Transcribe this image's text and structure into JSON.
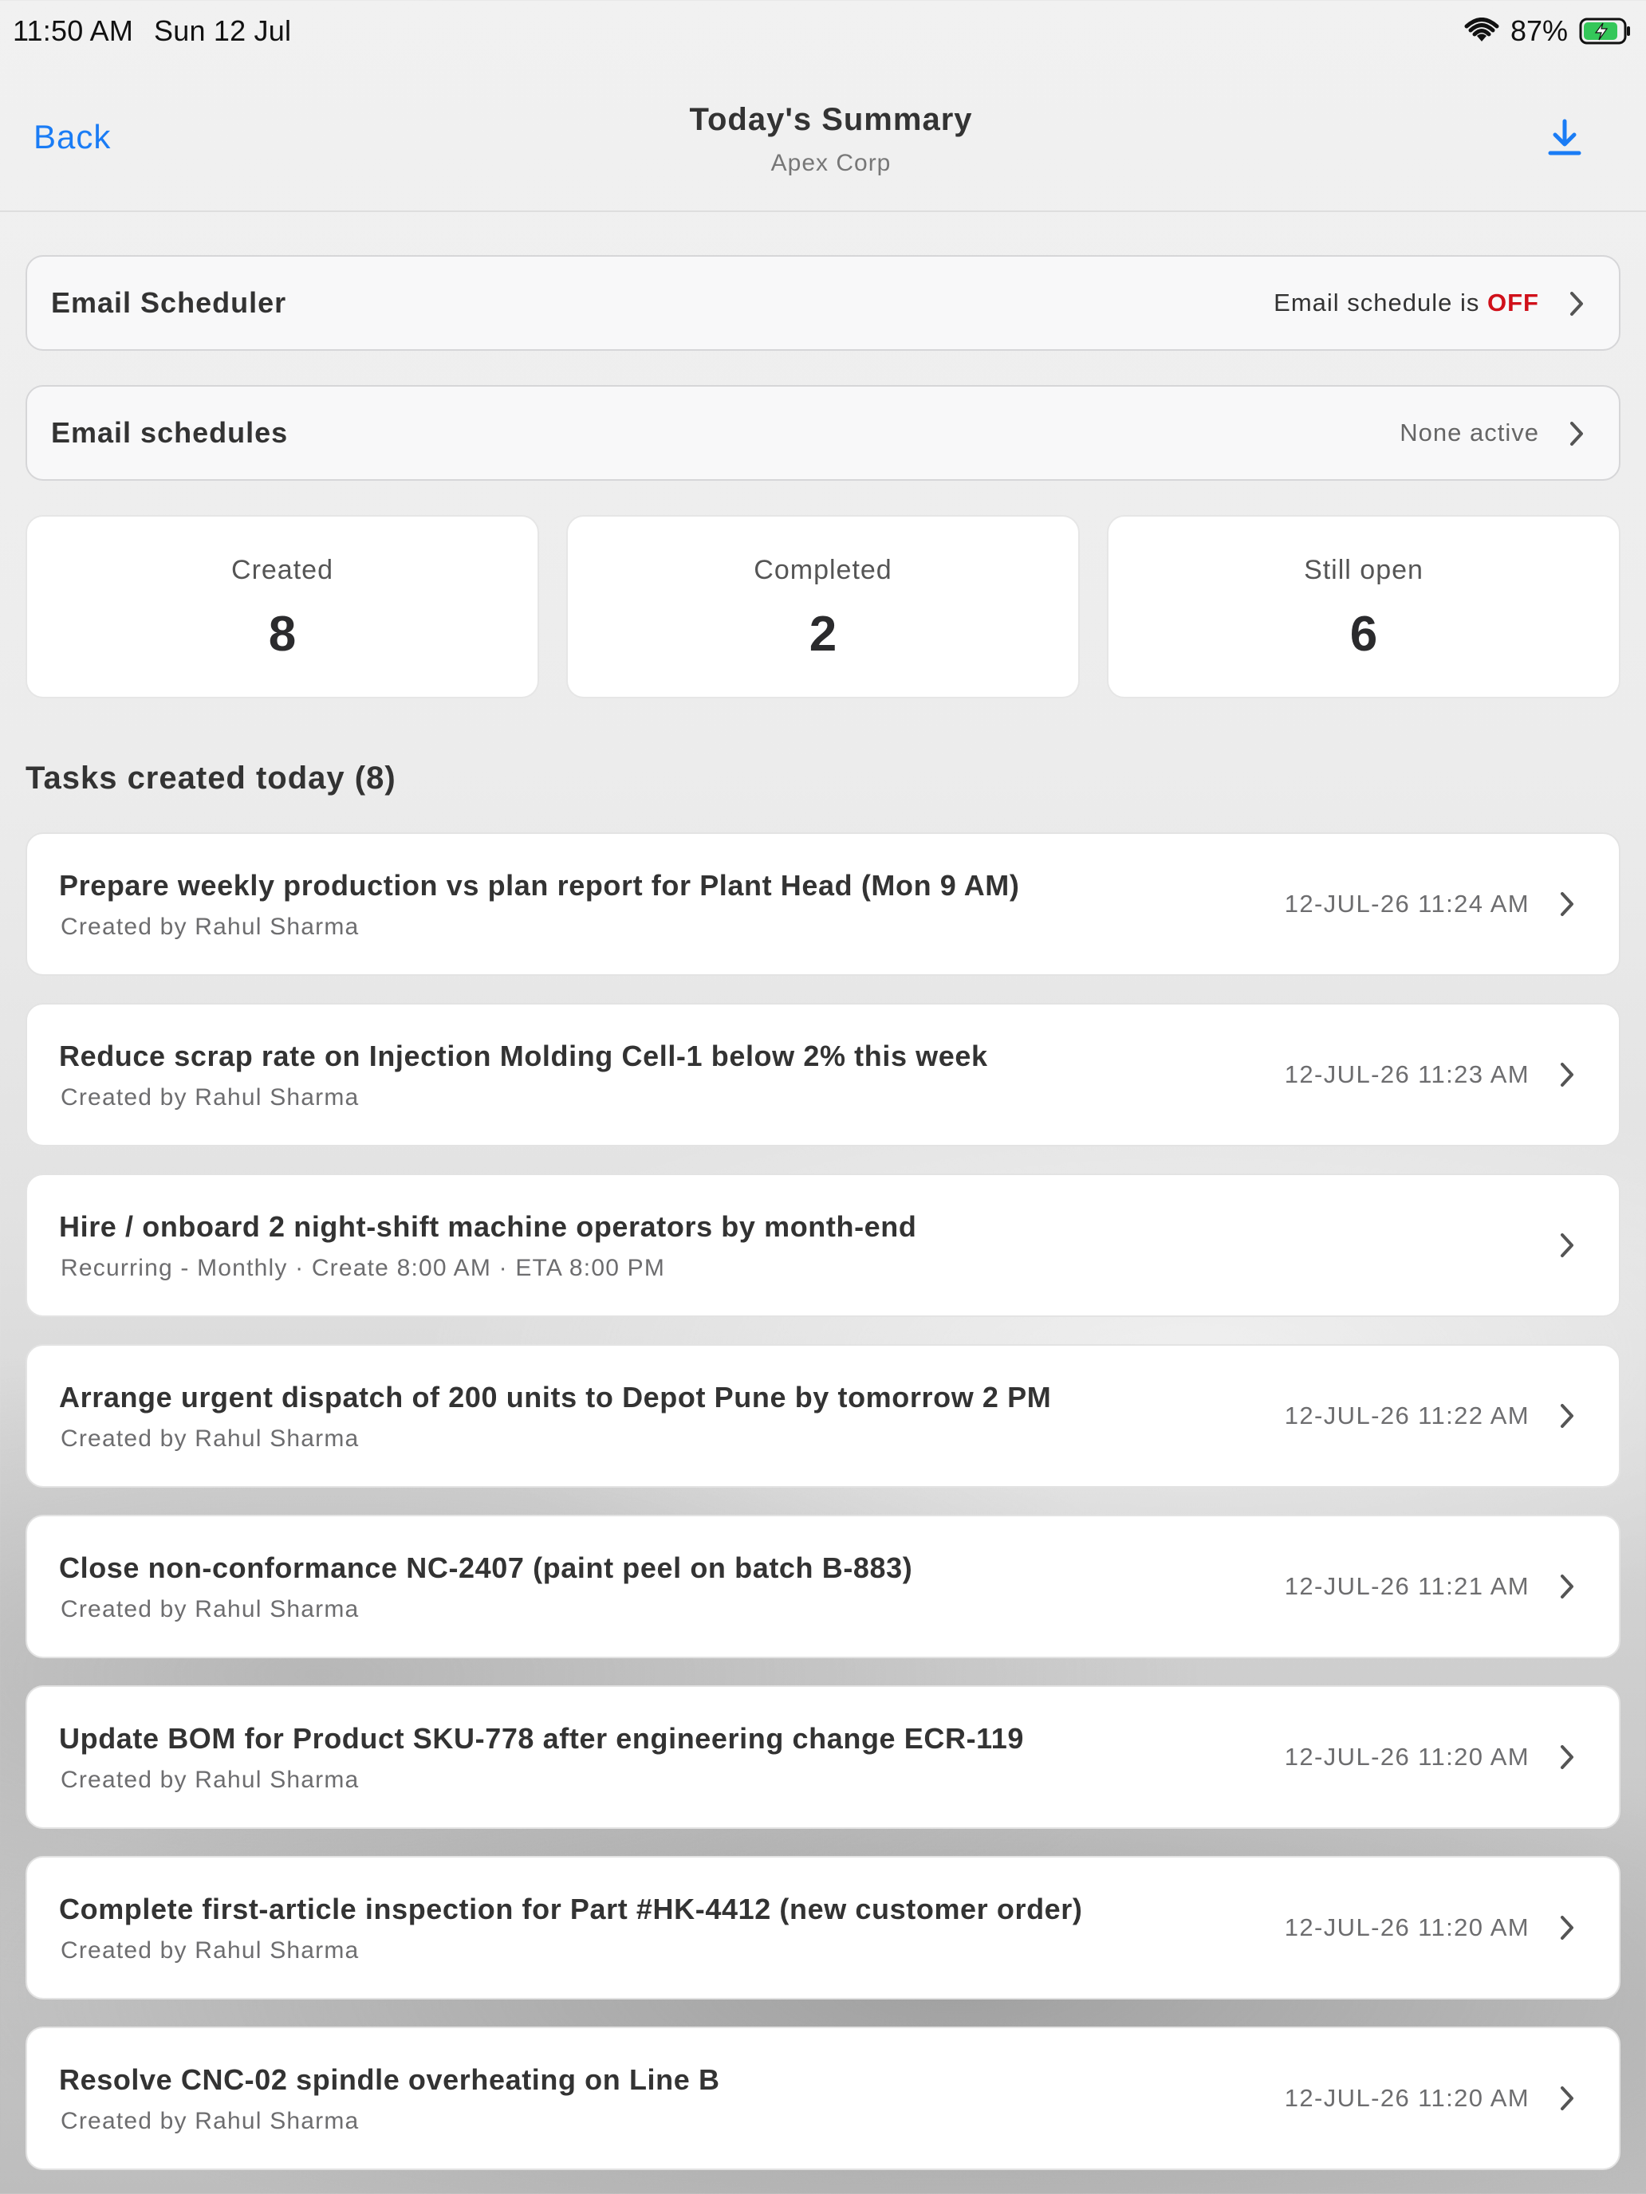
{
  "status_bar": {
    "time": "11:50 AM",
    "date": "Sun 12 Jul",
    "battery": "87%",
    "icons": [
      "wifi-icon",
      "battery-charging-icon"
    ]
  },
  "nav": {
    "back_label": "Back",
    "title": "Today's Summary",
    "subtitle": "Apex Corp",
    "download_icon": "download-icon"
  },
  "email_scheduler": {
    "label": "Email Scheduler",
    "value_prefix": "Email schedule is",
    "value_state": "OFF",
    "state_color": "#d0101a"
  },
  "email_schedules": {
    "label": "Email schedules",
    "value": "None active"
  },
  "stats": [
    {
      "label": "Created",
      "value": "8"
    },
    {
      "label": "Completed",
      "value": "2"
    },
    {
      "label": "Still open",
      "value": "6"
    }
  ],
  "tasks_section": {
    "title": "Tasks created today (8)"
  },
  "tasks": [
    {
      "title": "Prepare weekly production vs plan report for Plant Head (Mon 9 AM)",
      "subtitle": "Created by Rahul Sharma",
      "date": "12-JUL-26 11:24 AM"
    },
    {
      "title": "Reduce scrap rate on Injection Molding Cell-1 below 2% this week",
      "subtitle": "Created by Rahul Sharma",
      "date": "12-JUL-26 11:23 AM"
    },
    {
      "title": "Hire / onboard 2 night-shift machine operators by month-end",
      "subtitle": "Recurring - Monthly · Create 8:00 AM · ETA 8:00 PM",
      "date": ""
    },
    {
      "title": "Arrange urgent dispatch of 200 units to Depot Pune by tomorrow 2 PM",
      "subtitle": "Created by Rahul Sharma",
      "date": "12-JUL-26 11:22 AM"
    },
    {
      "title": "Close non-conformance NC-2407 (paint peel on batch B-883)",
      "subtitle": "Created by Rahul Sharma",
      "date": "12-JUL-26 11:21 AM"
    },
    {
      "title": "Update BOM for Product SKU-778 after engineering change ECR-119",
      "subtitle": "Created by Rahul Sharma",
      "date": "12-JUL-26 11:20 AM"
    },
    {
      "title": "Complete first-article inspection for Part #HK-4412 (new customer order)",
      "subtitle": "Created by Rahul Sharma",
      "date": "12-JUL-26 11:20 AM"
    },
    {
      "title": "Resolve CNC-02 spindle overheating on Line B",
      "subtitle": "Created by Rahul Sharma",
      "date": "12-JUL-26 11:20 AM"
    }
  ],
  "colors": {
    "accent": "#1a7cf5",
    "off": "#d0101a",
    "battery": "#34c759"
  }
}
